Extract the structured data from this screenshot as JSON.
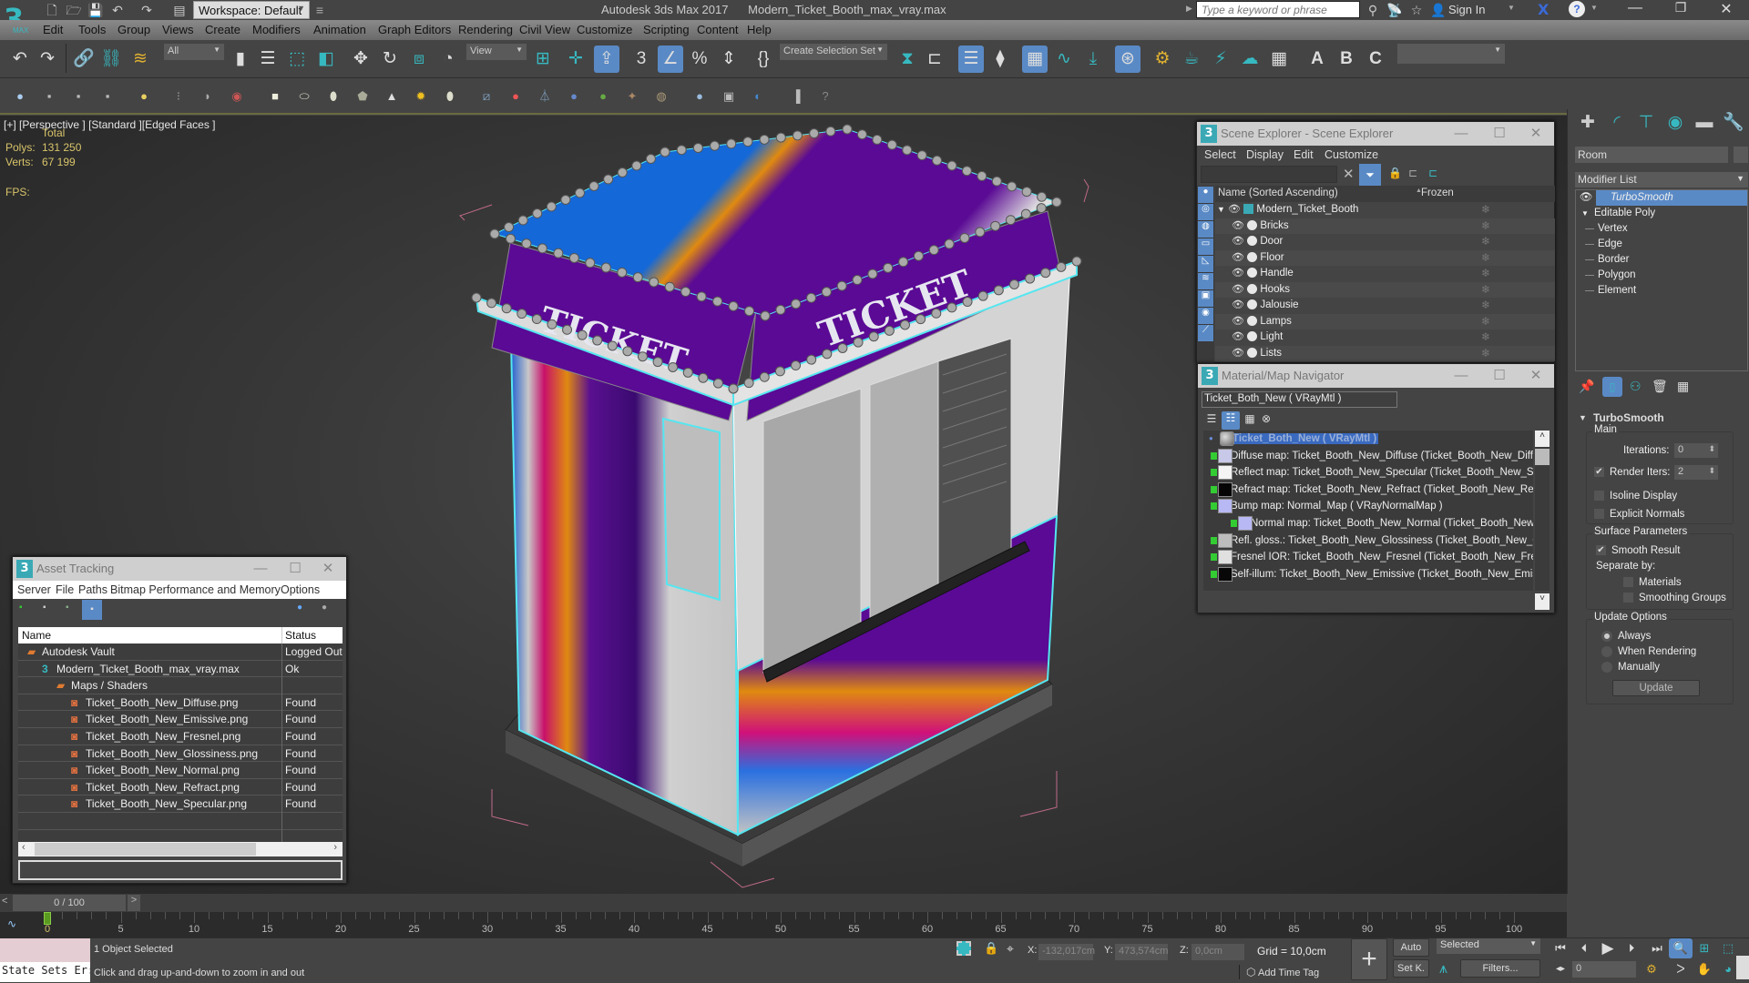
{
  "app": {
    "title": "Autodesk 3ds Max 2017",
    "file": "Modern_Ticket_Booth_max_vray.max",
    "workspace": "Workspace: Default",
    "search_placeholder": "Type a keyword or phrase",
    "sign_in": "Sign In"
  },
  "menu": [
    "Edit",
    "Tools",
    "Group",
    "Views",
    "Create",
    "Modifiers",
    "Animation",
    "Graph Editors",
    "Rendering",
    "Civil View",
    "Customize",
    "Scripting",
    "Content",
    "Help"
  ],
  "toolbar": {
    "selection_filter": "All",
    "ref_coord": "View",
    "named_selection": "Create Selection Set"
  },
  "viewport": {
    "label_plus": "[+]",
    "label_view": "[Perspective ]",
    "label_shading": "[Standard ]",
    "label_mode": "[Edged Faces ]",
    "stats_header": "Total",
    "polys_label": "Polys:",
    "polys_value": "131 250",
    "verts_label": "Verts:",
    "verts_value": "67 199",
    "fps_label": "FPS:",
    "model_texts": {
      "sign_left": "TICKET",
      "sign_right": "TICKET"
    }
  },
  "scene_explorer": {
    "title": "Scene Explorer - Scene Explorer",
    "menu": [
      "Select",
      "Display",
      "Edit",
      "Customize"
    ],
    "col_name": "Name (Sorted Ascending)",
    "col_frozen": "Frozen",
    "root": "Modern_Ticket_Booth",
    "items": [
      "Bricks",
      "Door",
      "Floor",
      "Handle",
      "Hooks",
      "Jalousie",
      "Lamps",
      "Light",
      "Lists"
    ]
  },
  "material_navigator": {
    "title": "Material/Map Navigator",
    "material_field": "Ticket_Both_New  ( VRayMtl )",
    "root": "Ticket_Both_New  ( VRayMtl )",
    "maps": [
      {
        "label": "Diffuse map: Ticket_Booth_New_Diffuse (Ticket_Booth_New_Diffuse.p",
        "thumb": "#c8c8e8",
        "indent": 0
      },
      {
        "label": "Reflect map: Ticket_Booth_New_Specular (Ticket_Booth_New_Specula",
        "thumb": "#f4f4f4",
        "indent": 0
      },
      {
        "label": "Refract map: Ticket_Booth_New_Refract (Ticket_Booth_New_Refract.p",
        "thumb": "#050505",
        "indent": 0
      },
      {
        "label": "Bump map: Normal_Map  ( VRayNormalMap )",
        "thumb": "#b8b8f4",
        "indent": 0
      },
      {
        "label": "Normal map: Ticket_Booth_New_Normal (Ticket_Booth_New_Normal",
        "thumb": "#b8b8f4",
        "indent": 1
      },
      {
        "label": "Refl. gloss.: Ticket_Booth_New_Glossiness (Ticket_Booth_New_Glossin",
        "thumb": "#bdbdbd",
        "indent": 0
      },
      {
        "label": "Fresnel IOR: Ticket_Booth_New_Fresnel (Ticket_Booth_New_Fresnel.p",
        "thumb": "#e0e0e0",
        "indent": 0
      },
      {
        "label": "Self-illum: Ticket_Booth_New_Emissive (Ticket_Booth_New_Emissive.p",
        "thumb": "#080808",
        "indent": 0
      }
    ]
  },
  "asset_tracking": {
    "title": "Asset Tracking",
    "menu": [
      "Server",
      "File",
      "Paths",
      "Bitmap Performance and Memory",
      "Options"
    ],
    "col_name": "Name",
    "col_status": "Status",
    "rows": [
      {
        "name": "Autodesk Vault",
        "status": "Logged Out",
        "level": 0,
        "icon": "vault"
      },
      {
        "name": "Modern_Ticket_Booth_max_vray.max",
        "status": "Ok",
        "level": 1,
        "icon": "max"
      },
      {
        "name": "Maps / Shaders",
        "status": "",
        "level": 2,
        "icon": "folder"
      },
      {
        "name": "Ticket_Booth_New_Diffuse.png",
        "status": "Found",
        "level": 3,
        "icon": "png"
      },
      {
        "name": "Ticket_Booth_New_Emissive.png",
        "status": "Found",
        "level": 3,
        "icon": "png"
      },
      {
        "name": "Ticket_Booth_New_Fresnel.png",
        "status": "Found",
        "level": 3,
        "icon": "png"
      },
      {
        "name": "Ticket_Booth_New_Glossiness.png",
        "status": "Found",
        "level": 3,
        "icon": "png"
      },
      {
        "name": "Ticket_Booth_New_Normal.png",
        "status": "Found",
        "level": 3,
        "icon": "png"
      },
      {
        "name": "Ticket_Booth_New_Refract.png",
        "status": "Found",
        "level": 3,
        "icon": "png"
      },
      {
        "name": "Ticket_Booth_New_Specular.png",
        "status": "Found",
        "level": 3,
        "icon": "png"
      }
    ]
  },
  "command_panel": {
    "object_name": "Room",
    "modifier_list": "Modifier List",
    "stack": [
      {
        "label": "TurboSmooth",
        "selected": true
      },
      {
        "label": "Editable Poly",
        "selected": false
      }
    ],
    "subobjects": [
      "Vertex",
      "Edge",
      "Border",
      "Polygon",
      "Element"
    ],
    "turbosmooth": {
      "title": "TurboSmooth",
      "main_group": "Main",
      "iterations_label": "Iterations:",
      "iterations_value": "0",
      "render_iters_label": "Render Iters:",
      "render_iters_value": "2",
      "render_iters_checked": true,
      "isoline_label": "Isoline Display",
      "isoline_checked": false,
      "explicit_label": "Explicit Normals",
      "explicit_checked": false,
      "surface_group": "Surface Parameters",
      "smooth_result_label": "Smooth Result",
      "smooth_result_checked": true,
      "separate_by": "Separate by:",
      "materials_label": "Materials",
      "smoothing_groups_label": "Smoothing Groups",
      "update_group": "Update Options",
      "update_always": "Always",
      "update_when_rendering": "When Rendering",
      "update_manually": "Manually",
      "update_selected": "Always",
      "update_button": "Update"
    }
  },
  "timeline": {
    "frame_display": "0 / 100",
    "current_frame": 0,
    "start": 0,
    "end": 100,
    "labels": [
      "0",
      "5",
      "10",
      "15",
      "20",
      "25",
      "30",
      "35",
      "40",
      "45",
      "50",
      "55",
      "60",
      "65",
      "70",
      "75",
      "80",
      "85",
      "90",
      "95",
      "100"
    ]
  },
  "status": {
    "selection": "1 Object Selected",
    "prompt": "Click and drag up-and-down to zoom in and out",
    "state_sets": "State Sets Er:",
    "x_label": "X:",
    "x_value": "-132,017cm",
    "y_label": "Y:",
    "y_value": "473,574cm",
    "z_label": "Z:",
    "z_value": "0,0cm",
    "grid": "Grid = 10,0cm",
    "add_time_tag": "Add Time Tag",
    "auto_key": "Auto",
    "set_key": "Set K.",
    "key_filter_select": "Selected",
    "filters": "Filters...",
    "frame_spinner": "0"
  },
  "colors": {
    "accent": "#5a8ac6",
    "teal": "#37b9c1",
    "stats_text": "#d8c46a",
    "selection_edge": "#55e6f0"
  }
}
